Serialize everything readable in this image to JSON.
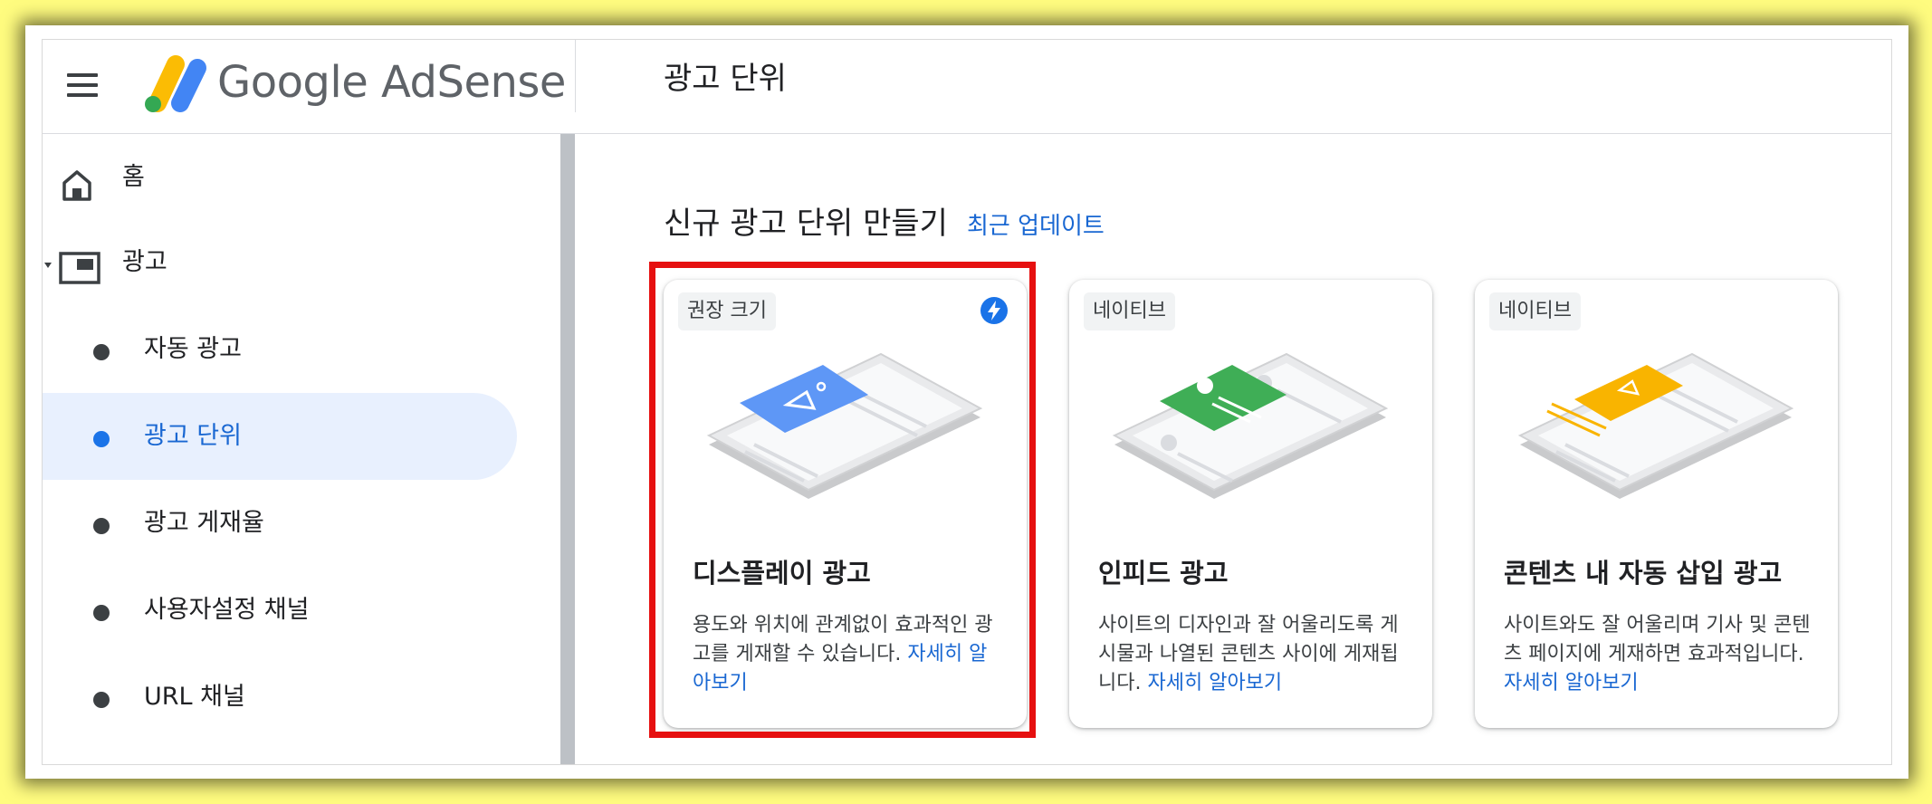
{
  "app": {
    "brand": "Google AdSense",
    "page_title": "광고 단위"
  },
  "sidebar": {
    "items": [
      {
        "label": "홈",
        "icon": "home-icon"
      },
      {
        "label": "광고",
        "icon": "ad-icon",
        "expanded": true
      },
      {
        "label": "자동 광고"
      },
      {
        "label": "광고 단위",
        "active": true
      },
      {
        "label": "광고 게재율"
      },
      {
        "label": "사용자설정 채널"
      },
      {
        "label": "URL 채널"
      }
    ]
  },
  "main": {
    "section_title": "신규 광고 단위 만들기",
    "recent_updates_link": "최근 업데이트",
    "cards": [
      {
        "chip": "권장 크기",
        "title": "디스플레이 광고",
        "description": "용도와 위치에 관계없이 효과적인 광고를 게재할 수 있습니다.",
        "link": "자세히 알아보기",
        "accent": "#5e97f6",
        "highlighted": true
      },
      {
        "chip": "네이티브",
        "title": "인피드 광고",
        "description": "사이트의 디자인과 잘 어울리도록 게시물과 나열된 콘텐츠 사이에 게재됩니다.",
        "link": "자세히 알아보기",
        "accent": "#3fae56"
      },
      {
        "chip": "네이티브",
        "title": "콘텐츠 내 자동 삽입 광고",
        "description": "사이트와도 잘 어울리며 기사 및 콘텐츠 페이지에 게재하면 효과적입니다.",
        "link": "자세히 알아보기",
        "accent": "#f9b400"
      }
    ]
  },
  "colors": {
    "link": "#1967d2",
    "active_bg": "#e8f0fe",
    "highlight_border": "#e61010",
    "outer_background": "#fffc7f"
  }
}
